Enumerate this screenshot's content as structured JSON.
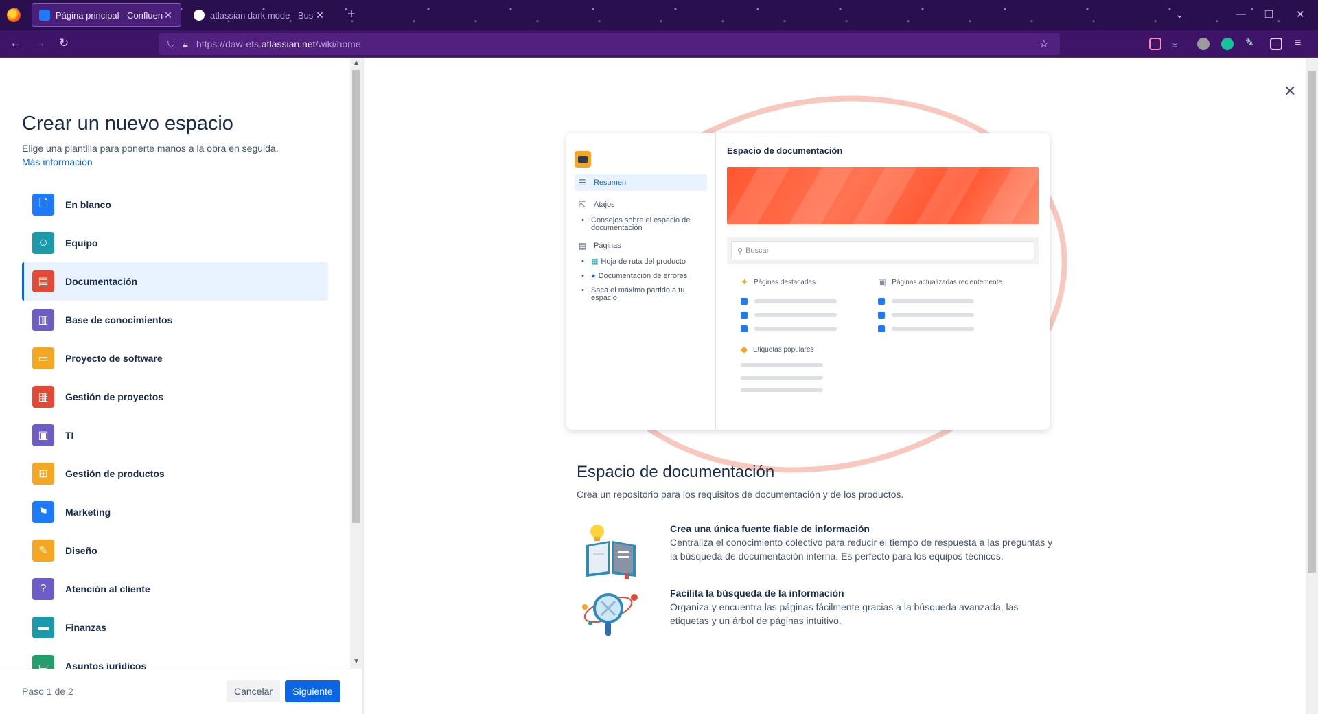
{
  "browser": {
    "tabs": [
      {
        "title": "Página principal - Confluence",
        "active": true
      },
      {
        "title": "atlassian dark mode - Buscar c",
        "active": false
      }
    ],
    "url_prefix": "https://daw-ets.",
    "url_domain": "atlassian.net",
    "url_path": "/wiki/home"
  },
  "left": {
    "title": "Crear un nuevo espacio",
    "subtitle": "Elige una plantilla para ponerte manos a la obra en seguida.",
    "more_link": "Más información",
    "templates": [
      {
        "label": "En blanco",
        "icon": "page-icon",
        "color": "#1d7afc",
        "selected": false
      },
      {
        "label": "Equipo",
        "icon": "people-icon",
        "color": "#1d9aaa",
        "selected": false
      },
      {
        "label": "Documentación",
        "icon": "archive-icon",
        "color": "#e34935",
        "selected": true
      },
      {
        "label": "Base de conocimientos",
        "icon": "book-icon",
        "color": "#6e5dc6",
        "selected": false
      },
      {
        "label": "Proyecto de software",
        "icon": "monitor-icon",
        "color": "#f5a623",
        "selected": false
      },
      {
        "label": "Gestión de proyectos",
        "icon": "clipboard-icon",
        "color": "#e34935",
        "selected": false
      },
      {
        "label": "TI",
        "icon": "computer-icon",
        "color": "#6e5dc6",
        "selected": false
      },
      {
        "label": "Gestión de productos",
        "icon": "grid-icon",
        "color": "#f5a623",
        "selected": false
      },
      {
        "label": "Marketing",
        "icon": "flag-icon",
        "color": "#1d7afc",
        "selected": false
      },
      {
        "label": "Diseño",
        "icon": "pencil-icon",
        "color": "#f5a623",
        "selected": false
      },
      {
        "label": "Atención al cliente",
        "icon": "question-icon",
        "color": "#6e5dc6",
        "selected": false
      },
      {
        "label": "Finanzas",
        "icon": "credit-card-icon",
        "color": "#1d9aaa",
        "selected": false
      },
      {
        "label": "Asuntos jurídicos",
        "icon": "briefcase-icon",
        "color": "#22a06b",
        "selected": false
      }
    ],
    "step": "Paso 1 de 2",
    "cancel": "Cancelar",
    "next": "Siguiente"
  },
  "preview": {
    "space_title": "Espacio de documentación",
    "nav": [
      {
        "label": "Resumen",
        "active": true
      },
      {
        "label": "Atajos",
        "active": false
      }
    ],
    "shortcut_items": [
      "Consejos sobre el espacio de documentación"
    ],
    "pages_label": "Páginas",
    "page_items": [
      "Hoja de ruta del producto",
      "Documentación de errores",
      "Saca el máximo partido a tu espacio"
    ],
    "search_placeholder": "Buscar",
    "featured_label": "Páginas destacadas",
    "recent_label": "Páginas actualizadas recientemente",
    "tags_label": "Etiquetas populares"
  },
  "detail": {
    "title": "Espacio de documentación",
    "subtitle": "Crea un repositorio para los requisitos de documentación y de los productos.",
    "features": [
      {
        "title": "Crea una única fuente fiable de información",
        "desc": "Centraliza el conocimiento colectivo para reducir el tiempo de respuesta a las preguntas y la búsqueda de documentación interna. Es perfecto para los equipos técnicos."
      },
      {
        "title": "Facilita la búsqueda de la información",
        "desc": "Organiza y encuentra las páginas fácilmente gracias a la búsqueda avanzada, las etiquetas y un árbol de páginas intuitivo."
      }
    ]
  }
}
